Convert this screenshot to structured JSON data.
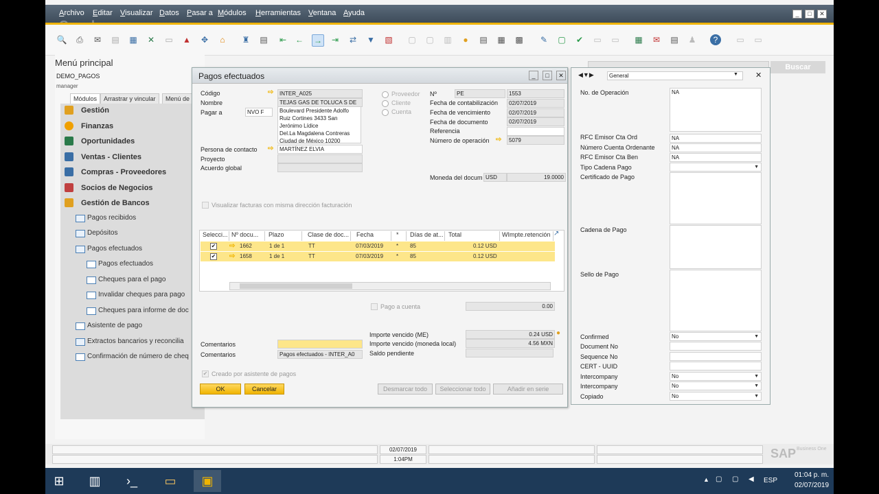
{
  "menubar": {
    "items": [
      "Archivo",
      "Editar",
      "Visualizar",
      "Datos",
      "Pasar a",
      "Módulos",
      "Herramientas",
      "Ventana",
      "Ayuda"
    ],
    "watermark": "Google"
  },
  "search": {
    "placeholder": "Buscar"
  },
  "main_menu": {
    "title": "Menú principal",
    "company": "DEMO_PAGOS",
    "user": "manager",
    "tabs": [
      "Módulos",
      "Arrastrar y vincular",
      "Menú de"
    ],
    "modules": [
      {
        "label": "Gestión",
        "color": "#e0a020"
      },
      {
        "label": "Finanzas",
        "color": "#f0a000"
      },
      {
        "label": "Oportunidades",
        "color": "#2a7a4a"
      },
      {
        "label": "Ventas - Clientes",
        "color": "#3a6ea5"
      },
      {
        "label": "Compras - Proveedores",
        "color": "#3a6ea5"
      },
      {
        "label": "Socios de Negocios",
        "color": "#c04040"
      },
      {
        "label": "Gestión de Bancos",
        "color": "#e0a020"
      }
    ],
    "submodules": [
      {
        "label": "Pagos recibidos",
        "level": 1
      },
      {
        "label": "Depósitos",
        "level": 1
      },
      {
        "label": "Pagos efectuados",
        "level": 1
      },
      {
        "label": "Pagos efectuados",
        "level": 2
      },
      {
        "label": "Cheques para el pago",
        "level": 2
      },
      {
        "label": "Invalidar cheques para pago",
        "level": 2
      },
      {
        "label": "Cheques para informe de doc",
        "level": 2
      },
      {
        "label": "Asistente de pago",
        "level": 1
      },
      {
        "label": "Extractos bancarios y reconcilia",
        "level": 1
      },
      {
        "label": "Confirmación de número de cheq",
        "level": 1
      }
    ]
  },
  "pagos": {
    "title": "Pagos efectuados",
    "codigo_label": "Código",
    "codigo": "INTER_A025",
    "nombre_label": "Nombre",
    "nombre": "TEJAS GAS DE TOLUCA S DE",
    "pagar_a_label": "Pagar a",
    "pagar_a": "NVO F",
    "address": [
      "Boulevard Presidente Adolfo",
      "Ruiz Cortines 3433 San",
      "Jerónimo Lídice",
      "Del.La Magdalena Contreras",
      "Ciudad de México 10200"
    ],
    "contacto_label": "Persona de contacto",
    "contacto": "MARTÍNEZ ELVIA",
    "proyecto_label": "Proyecto",
    "acuerdo_label": "Acuerdo global",
    "radios": [
      "Proveedor",
      "Cliente",
      "Cuenta"
    ],
    "no_label": "Nº",
    "serie": "PE",
    "numero": "1553",
    "fecha_cont_label": "Fecha de contabilización",
    "fecha_cont": "02/07/2019",
    "fecha_venc_label": "Fecha de vencimiento",
    "fecha_venc": "02/07/2019",
    "fecha_doc_label": "Fecha de documento",
    "fecha_doc": "02/07/2019",
    "referencia_label": "Referencia",
    "num_op_label": "Número de operación",
    "num_op": "5079",
    "moneda_label": "Moneda del docum",
    "moneda": "USD",
    "tipo_cambio": "19.0000",
    "visualizar_label": "Visualizar facturas con misma dirección facturación",
    "grid": {
      "headers": [
        "Selecci...",
        "Nº docu...",
        "Plazo",
        "Clase de doc...",
        "Fecha",
        "*",
        "Días de at...",
        "Total",
        "WImpte.retención"
      ],
      "rows": [
        {
          "doc": "1662",
          "plazo": "1 de 1",
          "clase": "TT",
          "fecha": "07/03/2019",
          "star": "*",
          "dias": "85",
          "total": "0.12 USD"
        },
        {
          "doc": "1658",
          "plazo": "1 de 1",
          "clase": "TT",
          "fecha": "07/03/2019",
          "star": "*",
          "dias": "85",
          "total": "0.12 USD"
        }
      ]
    },
    "pago_cuenta_label": "Pago a cuenta",
    "pago_cuenta": "0.00",
    "importe_me_label": "Importe vencido (ME)",
    "importe_me": "0.24 USD",
    "importe_ml_label": "Importe vencido (moneda local)",
    "importe_ml": "4.56 MXN",
    "saldo_label": "Saldo pendiente",
    "comentarios_label": "Comentarios",
    "comentarios2_label": "Comentarios",
    "comentarios2": "Pagos efectuados - INTER_A0",
    "creado_label": "Creado por asistente de pagos",
    "ok": "OK",
    "cancelar": "Cancelar",
    "desmarcar": "Desmarcar todo",
    "seleccionar": "Seleccionar todo",
    "anadir": "Añadir en serie"
  },
  "right_panel": {
    "tab": "General",
    "fields": [
      {
        "label": "No. de Operación",
        "value": "NA"
      },
      {
        "label": "RFC Emisor Cta Ord",
        "value": "NA"
      },
      {
        "label": "Número Cuenta Ordenante",
        "value": "NA"
      },
      {
        "label": "RFC Emisor Cta Ben",
        "value": "NA"
      },
      {
        "label": "Tipo Cadena Pago",
        "value": ""
      },
      {
        "label": "Certificado de Pago",
        "value": ""
      },
      {
        "label": "Cadena de Pago",
        "value": ""
      },
      {
        "label": "Sello de Pago",
        "value": ""
      },
      {
        "label": "Confirmed",
        "value": "No"
      },
      {
        "label": "Document No",
        "value": ""
      },
      {
        "label": "Sequence No",
        "value": ""
      },
      {
        "label": "CERT - UUID",
        "value": ""
      },
      {
        "label": "Intercompany",
        "value": "No"
      },
      {
        "label": "Intercompany",
        "value": "No"
      },
      {
        "label": "Copiado",
        "value": "No"
      }
    ]
  },
  "status": {
    "date": "02/07/2019",
    "time": "1:04PM",
    "brand": "SAP",
    "brand2": "Business One"
  },
  "taskbar": {
    "lang": "ESP",
    "clock_time": "01:04 p. m.",
    "clock_date": "02/07/2019"
  }
}
